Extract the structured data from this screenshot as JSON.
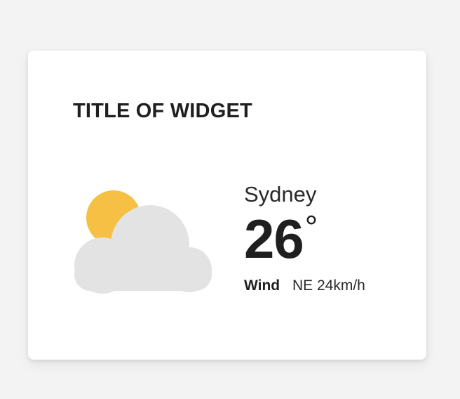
{
  "widget": {
    "title": "TITLE OF WIDGET",
    "icon": "partly-cloudy-icon",
    "city": "Sydney",
    "temperature": "26",
    "degree_symbol": "°",
    "wind_label": "Wind",
    "wind_value": "NE 24km/h"
  },
  "colors": {
    "background": "#f3f3f3",
    "card": "#ffffff",
    "sun": "#f5c044",
    "cloud": "#e3e3e3",
    "text": "#1f1f1f"
  }
}
